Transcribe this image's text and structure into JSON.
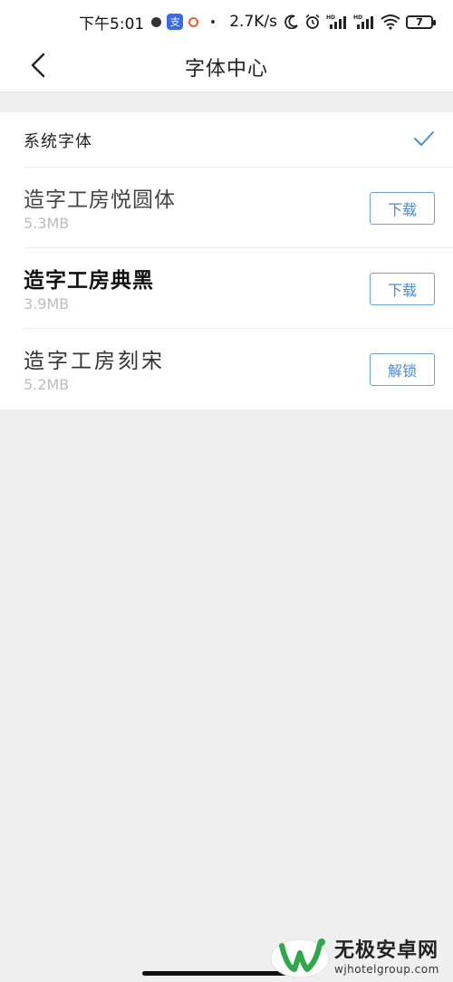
{
  "status_bar": {
    "time": "下午5:01",
    "app_icon_glyph": "支",
    "net_speed": "2.7K/s",
    "signal1_label": "HD",
    "signal2_label": "HD",
    "battery": "7"
  },
  "header": {
    "title": "字体中心"
  },
  "fonts": {
    "system": {
      "name": "系统字体",
      "selected": true
    },
    "items": [
      {
        "name": "造字工房悦圆体",
        "size": "5.3MB",
        "action": "下载"
      },
      {
        "name": "造字工房典黑",
        "size": "3.9MB",
        "action": "下载"
      },
      {
        "name": "造字工房刻宋",
        "size": "5.2MB",
        "action": "解锁"
      }
    ]
  },
  "watermark": {
    "title": "无极安卓网",
    "url": "wjhotelgroup.com"
  },
  "colors": {
    "accent": "#4c8ccc",
    "background": "#efefef",
    "watermark_green": "#2da84a"
  }
}
